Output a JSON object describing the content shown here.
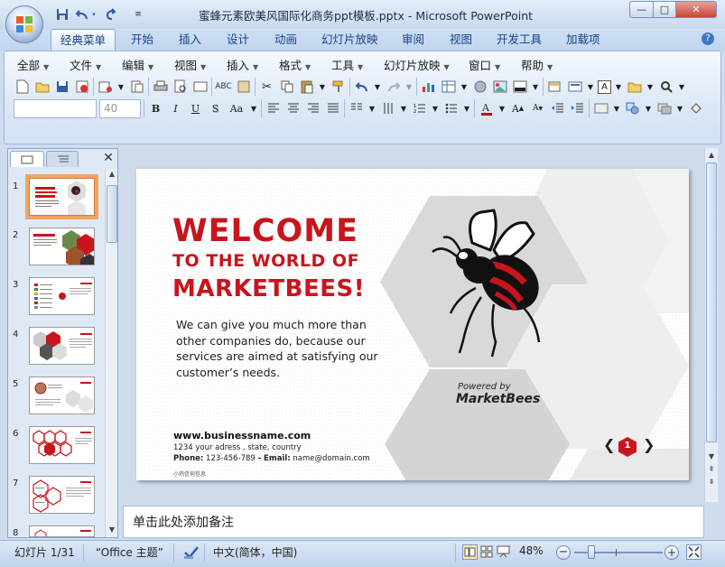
{
  "window": {
    "title": "蜜蜂元素欧美风国际化商务ppt模板.pptx - Microsoft PowerPoint",
    "min": "—",
    "max": "□",
    "close": "✕"
  },
  "tabs": [
    "经典菜单",
    "开始",
    "插入",
    "设计",
    "动画",
    "幻灯片放映",
    "审阅",
    "视图",
    "开发工具",
    "加载项"
  ],
  "menus": [
    "全部",
    "文件",
    "编辑",
    "视图",
    "插入",
    "格式",
    "工具",
    "幻灯片放映",
    "窗口",
    "帮助"
  ],
  "font_size_value": "40",
  "slide": {
    "heading1": "WELCOME",
    "heading2": "TO THE WORLD OF",
    "heading3": "MARKETBEES!",
    "body_lines": [
      "We can give you much more than",
      "other companies do, because our",
      "services are aimed at satisfying our",
      "customer’s needs."
    ],
    "website": "www.businessname.com",
    "address": "1234 your adress , state, country",
    "phone_label": "Phone:",
    "phone": "123-456-789",
    "email_label": "- Email:",
    "email": "name@domain.com",
    "watermark": "小鸡信何信息",
    "powered_by": "Powered by",
    "brand": "MarketBees",
    "page_number": "1",
    "prev": "❮",
    "next": "❯"
  },
  "slide_numbers": [
    "1",
    "2",
    "3",
    "4",
    "5",
    "6",
    "7",
    "8"
  ],
  "notes_placeholder": "单击此处添加备注",
  "status": {
    "slide_indicator": "幻灯片 1/31",
    "theme": "“Office 主题”",
    "language": "中文(简体，中国)",
    "zoom": "48%"
  },
  "colors": {
    "accent_red": "#c8151d",
    "ribbon_blue": "#15428b",
    "selection_orange": "#f2a462"
  }
}
